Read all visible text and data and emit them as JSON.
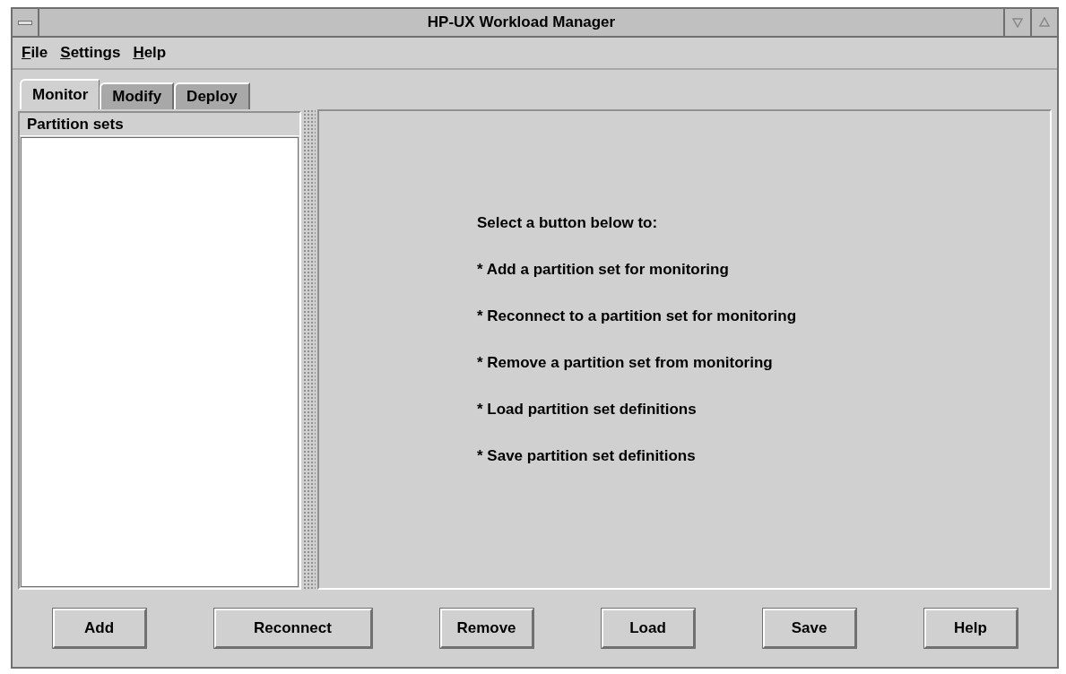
{
  "window": {
    "title": "HP-UX Workload Manager"
  },
  "menu": [
    {
      "label": "File"
    },
    {
      "label": "Settings"
    },
    {
      "label": "Help"
    }
  ],
  "tabs": [
    {
      "label": "Monitor",
      "selected": true
    },
    {
      "label": "Modify",
      "selected": false
    },
    {
      "label": "Deploy",
      "selected": false
    }
  ],
  "partition_list": {
    "title": "Partition sets"
  },
  "instructions": [
    "Select a button below to:",
    "* Add a partition set for monitoring",
    "* Reconnect to a partition set for monitoring",
    "* Remove a partition set from monitoring",
    "* Load partition set definitions",
    "* Save partition set definitions"
  ],
  "buttons": [
    "Add",
    "Reconnect",
    "Remove",
    "Load",
    "Save",
    "Help"
  ]
}
